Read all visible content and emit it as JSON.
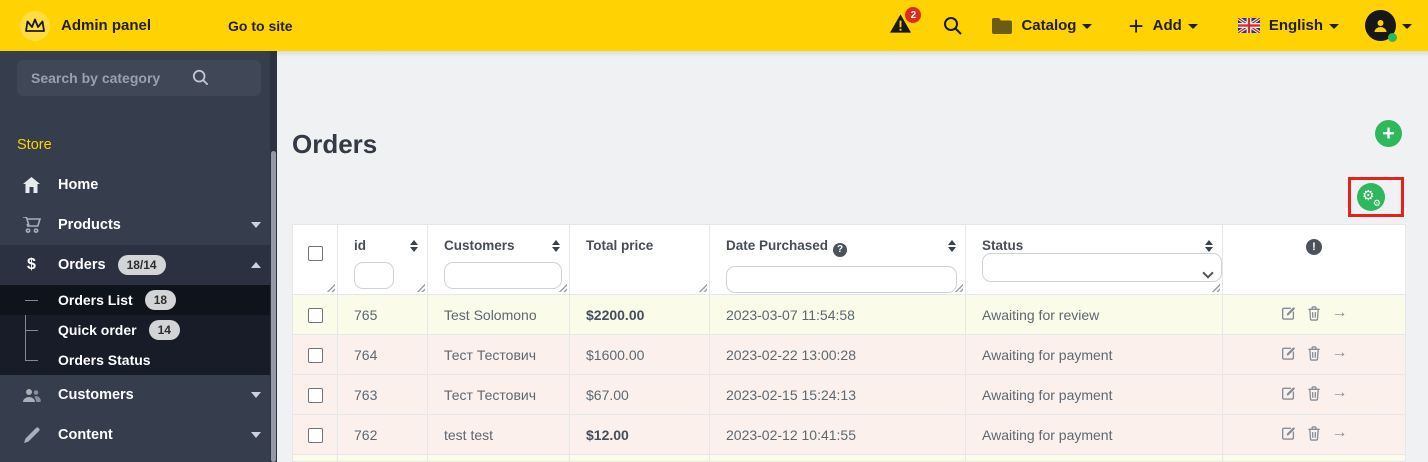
{
  "topbar": {
    "brand": "Admin panel",
    "go_to_site": "Go to site",
    "alerts_badge": "2",
    "catalog_label": "Catalog",
    "add_label": "Add",
    "language_label": "English"
  },
  "sidebar": {
    "search_placeholder": "Search by category",
    "section_label": "Store",
    "home_label": "Home",
    "products_label": "Products",
    "orders_label": "Orders",
    "orders_badge": "18/14",
    "orders_list_label": "Orders List",
    "orders_list_badge": "18",
    "quick_order_label": "Quick order",
    "quick_order_badge": "14",
    "orders_status_label": "Orders Status",
    "customers_label": "Customers",
    "content_label": "Content"
  },
  "main": {
    "title": "Orders"
  },
  "table": {
    "headers": {
      "id": "id",
      "customers": "Customers",
      "total_price": "Total price",
      "date_purchased": "Date Purchased",
      "status": "Status"
    },
    "rows": [
      {
        "id": "765",
        "customer": "Test Solomono",
        "total": "$2200.00",
        "total_bold": true,
        "date": "2023-03-07 11:54:58",
        "status": "Awaiting for review",
        "tone": "yellow"
      },
      {
        "id": "764",
        "customer": "Тест Тестович",
        "total": "$1600.00",
        "total_bold": false,
        "date": "2023-02-22 13:00:28",
        "status": "Awaiting for payment",
        "tone": "pink"
      },
      {
        "id": "763",
        "customer": "Тест Тестович",
        "total": "$67.00",
        "total_bold": false,
        "date": "2023-02-15 15:24:13",
        "status": "Awaiting for payment",
        "tone": "pink"
      },
      {
        "id": "762",
        "customer": "test test",
        "total": "$12.00",
        "total_bold": true,
        "date": "2023-02-12 10:41:55",
        "status": "Awaiting for payment",
        "tone": "pink"
      }
    ]
  },
  "icons": {
    "dollar": "$",
    "plus": "+",
    "gear": "⚙",
    "help": "?",
    "info": "!",
    "arrow_right": "→"
  },
  "colors": {
    "topbar_yellow": "#ffd203",
    "sidebar_dark": "#363d4c",
    "accent_green": "#2eb85c",
    "highlight_red": "#e32219",
    "row_yellow": "#fbfbe9",
    "row_pink": "#fbf0ec"
  }
}
